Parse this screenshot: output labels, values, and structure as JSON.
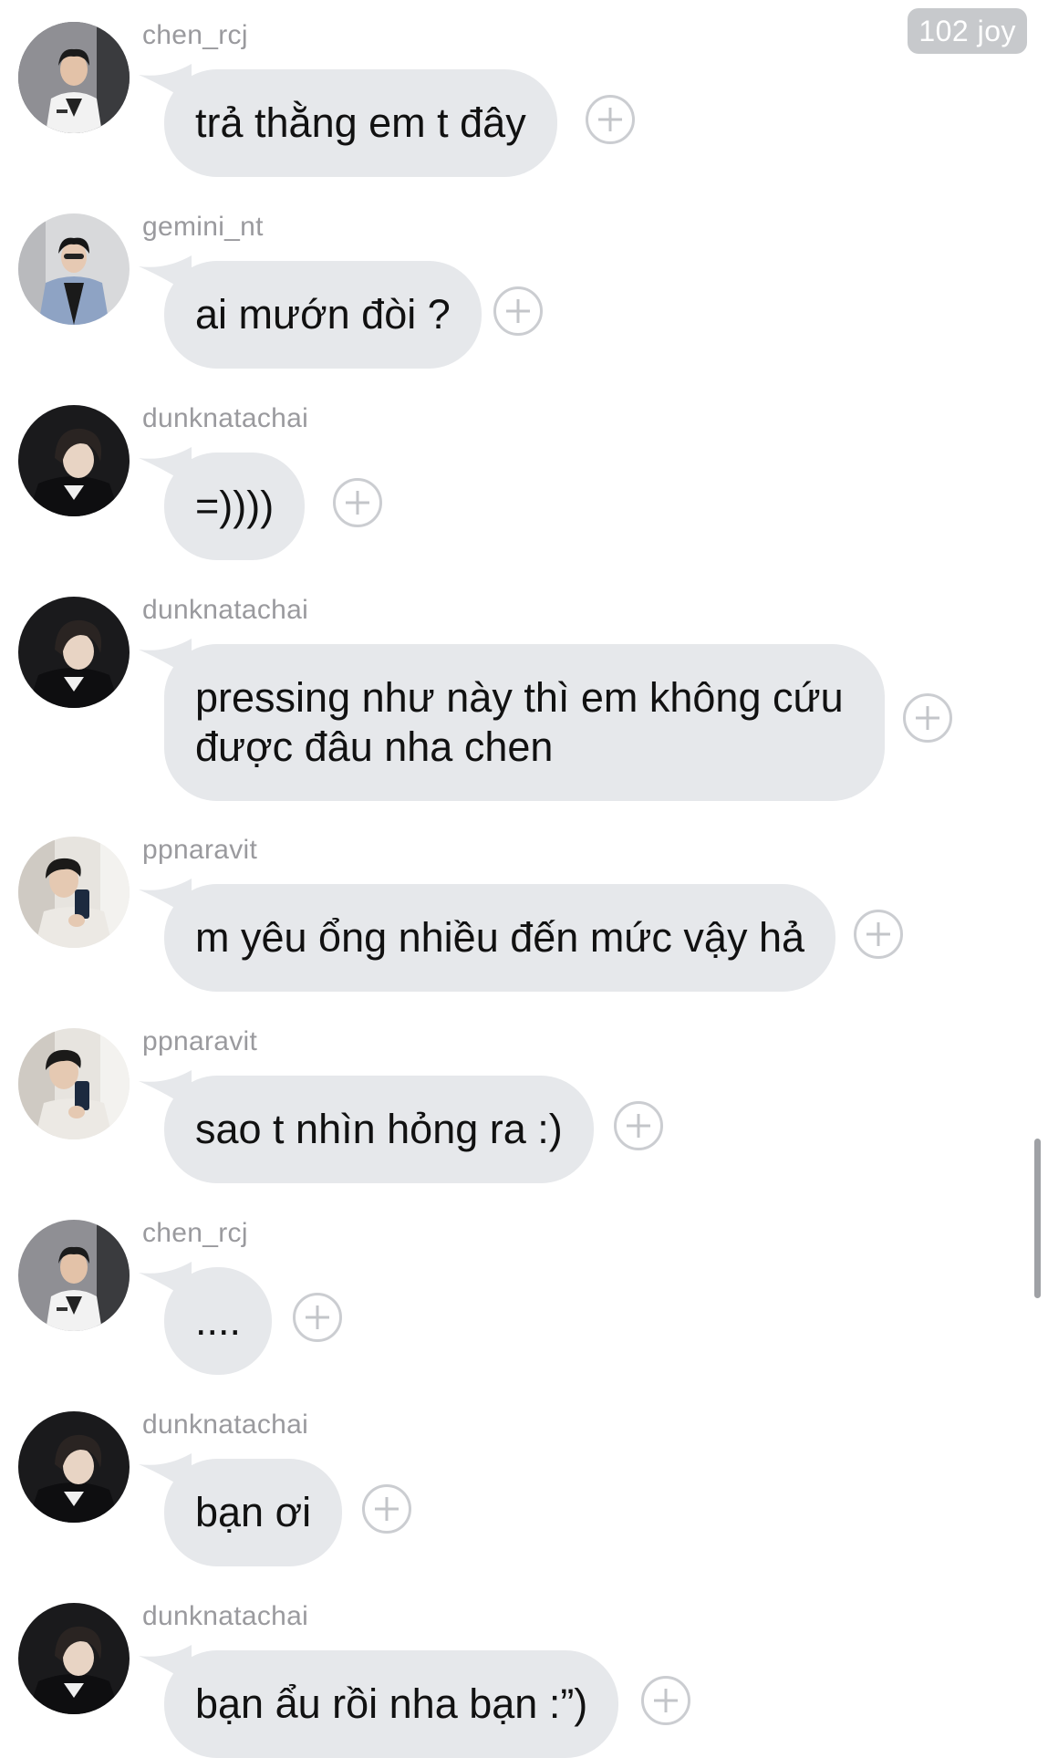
{
  "badge": {
    "count": "102 joy"
  },
  "messages": [
    {
      "user": "chen_rcj",
      "text": "trả thằng em t đây",
      "avatar": "avatar-chen"
    },
    {
      "user": "gemini_nt",
      "text": "ai mướn đòi ?",
      "avatar": "avatar-gemini"
    },
    {
      "user": "dunknatachai",
      "text": "=))))",
      "avatar": "avatar-dunk"
    },
    {
      "user": "dunknatachai",
      "text": "pressing như này thì em không cứu được đâu nha chen",
      "avatar": "avatar-dunk"
    },
    {
      "user": "ppnaravit",
      "text": "m yêu ổng nhiều đến mức vậy hả",
      "avatar": "avatar-pp"
    },
    {
      "user": "ppnaravit",
      "text": "sao t nhìn hỏng ra :)",
      "avatar": "avatar-pp"
    },
    {
      "user": "chen_rcj",
      "text": "....",
      "avatar": "avatar-chen"
    },
    {
      "user": "dunknatachai",
      "text": "bạn ơi",
      "avatar": "avatar-dunk"
    },
    {
      "user": "dunknatachai",
      "text": "bạn ẩu rồi nha bạn :”)",
      "avatar": "avatar-dunk"
    }
  ],
  "colors": {
    "bubble": "#e6e8eb",
    "username": "#9a9a9e",
    "badge": "#c7c9cc"
  }
}
